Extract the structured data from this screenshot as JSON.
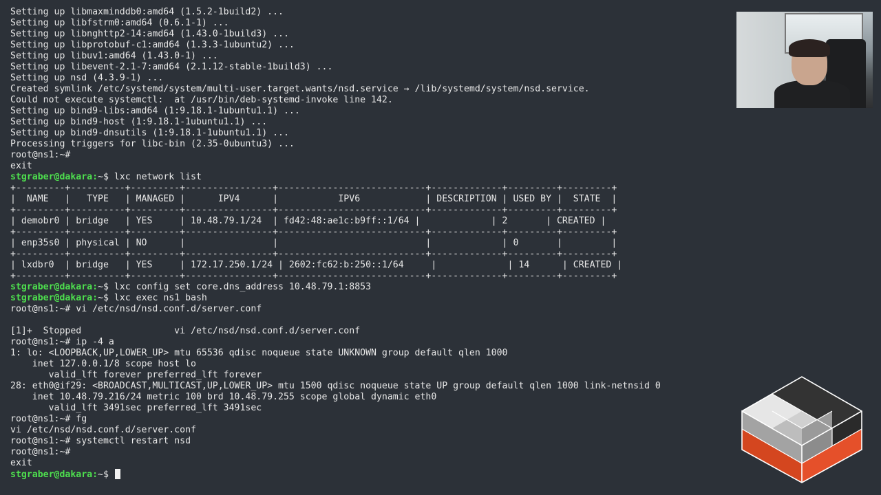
{
  "terminal": {
    "lines": [
      [
        {
          "t": "Setting up libmaxminddb0:amd64 (1.5.2-1build2) ..."
        }
      ],
      [
        {
          "t": "Setting up libfstrm0:amd64 (0.6.1-1) ..."
        }
      ],
      [
        {
          "t": "Setting up libnghttp2-14:amd64 (1.43.0-1build3) ..."
        }
      ],
      [
        {
          "t": "Setting up libprotobuf-c1:amd64 (1.3.3-1ubuntu2) ..."
        }
      ],
      [
        {
          "t": "Setting up libuv1:amd64 (1.43.0-1) ..."
        }
      ],
      [
        {
          "t": "Setting up libevent-2.1-7:amd64 (2.1.12-stable-1build3) ..."
        }
      ],
      [
        {
          "t": "Setting up nsd (4.3.9-1) ..."
        }
      ],
      [
        {
          "t": "Created symlink /etc/systemd/system/multi-user.target.wants/nsd.service → /lib/systemd/system/nsd.service."
        }
      ],
      [
        {
          "t": "Could not execute systemctl:  at /usr/bin/deb-systemd-invoke line 142."
        }
      ],
      [
        {
          "t": "Setting up bind9-libs:amd64 (1:9.18.1-1ubuntu1.1) ..."
        }
      ],
      [
        {
          "t": "Setting up bind9-host (1:9.18.1-1ubuntu1.1) ..."
        }
      ],
      [
        {
          "t": "Setting up bind9-dnsutils (1:9.18.1-1ubuntu1.1) ..."
        }
      ],
      [
        {
          "t": "Processing triggers for libc-bin (2.35-0ubuntu3) ..."
        }
      ],
      [
        {
          "t": "root@ns1:~#"
        }
      ],
      [
        {
          "t": "exit"
        }
      ],
      [
        {
          "t": "stgraber@dakara:",
          "c": "user"
        },
        {
          "t": "~$ lxc network list"
        }
      ],
      [
        {
          "t": "+---------+----------+---------+----------------+---------------------------+-------------+---------+---------+"
        }
      ],
      [
        {
          "t": "|  NAME   |   TYPE   | MANAGED |      IPV4      |           IPV6            | DESCRIPTION | USED BY |  STATE  |"
        }
      ],
      [
        {
          "t": "+---------+----------+---------+----------------+---------------------------+-------------+---------+---------+"
        }
      ],
      [
        {
          "t": "| demobr0 | bridge   | YES     | 10.48.79.1/24  | fd42:48:ae1c:b9ff::1/64 |             | 2       | CREATED |"
        }
      ],
      [
        {
          "t": "+---------+----------+---------+----------------+---------------------------+-------------+---------+---------+"
        }
      ],
      [
        {
          "t": "| enp35s0 | physical | NO      |                |                           |             | 0       |         |"
        }
      ],
      [
        {
          "t": "+---------+----------+---------+----------------+---------------------------+-------------+---------+---------+"
        }
      ],
      [
        {
          "t": "| lxdbr0  | bridge   | YES     | 172.17.250.1/24 | 2602:fc62:b:250::1/64     |             | 14      | CREATED |"
        }
      ],
      [
        {
          "t": "+---------+----------+---------+----------------+---------------------------+-------------+---------+---------+"
        }
      ],
      [
        {
          "t": "stgraber@dakara:",
          "c": "user"
        },
        {
          "t": "~$ lxc config set core.dns_address 10.48.79.1:8853"
        }
      ],
      [
        {
          "t": "stgraber@dakara:",
          "c": "user"
        },
        {
          "t": "~$ lxc exec ns1 bash"
        }
      ],
      [
        {
          "t": "root@ns1:~# vi /etc/nsd/nsd.conf.d/server.conf"
        }
      ],
      [
        {
          "t": ""
        }
      ],
      [
        {
          "t": "[1]+  Stopped                 vi /etc/nsd/nsd.conf.d/server.conf"
        }
      ],
      [
        {
          "t": "root@ns1:~# ip -4 a"
        }
      ],
      [
        {
          "t": "1: lo: <LOOPBACK,UP,LOWER_UP> mtu 65536 qdisc noqueue state UNKNOWN group default qlen 1000"
        }
      ],
      [
        {
          "t": "    inet 127.0.0.1/8 scope host lo"
        }
      ],
      [
        {
          "t": "       valid_lft forever preferred_lft forever"
        }
      ],
      [
        {
          "t": "28: eth0@if29: <BROADCAST,MULTICAST,UP,LOWER_UP> mtu 1500 qdisc noqueue state UP group default qlen 1000 link-netnsid 0"
        }
      ],
      [
        {
          "t": "    inet 10.48.79.216/24 metric 100 brd 10.48.79.255 scope global dynamic eth0"
        }
      ],
      [
        {
          "t": "       valid_lft 3491sec preferred_lft 3491sec"
        }
      ],
      [
        {
          "t": "root@ns1:~# fg"
        }
      ],
      [
        {
          "t": "vi /etc/nsd/nsd.conf.d/server.conf"
        }
      ],
      [
        {
          "t": "root@ns1:~# systemctl restart nsd"
        }
      ],
      [
        {
          "t": "root@ns1:~#"
        }
      ],
      [
        {
          "t": "exit"
        }
      ],
      [
        {
          "t": "stgraber@dakara:",
          "c": "user"
        },
        {
          "t": "~$ "
        }
      ]
    ]
  },
  "colors": {
    "background": "#2c3138",
    "text": "#e8e8e8",
    "prompt_user": "#4ee04e",
    "logo_orange": "#e5502a",
    "logo_dark": "#333333",
    "logo_gray": "#a8a8a8",
    "logo_light": "#d9d9d9"
  },
  "icons": {
    "logo": "lxd-cube-logo",
    "webcam": "presenter-webcam-feed"
  }
}
